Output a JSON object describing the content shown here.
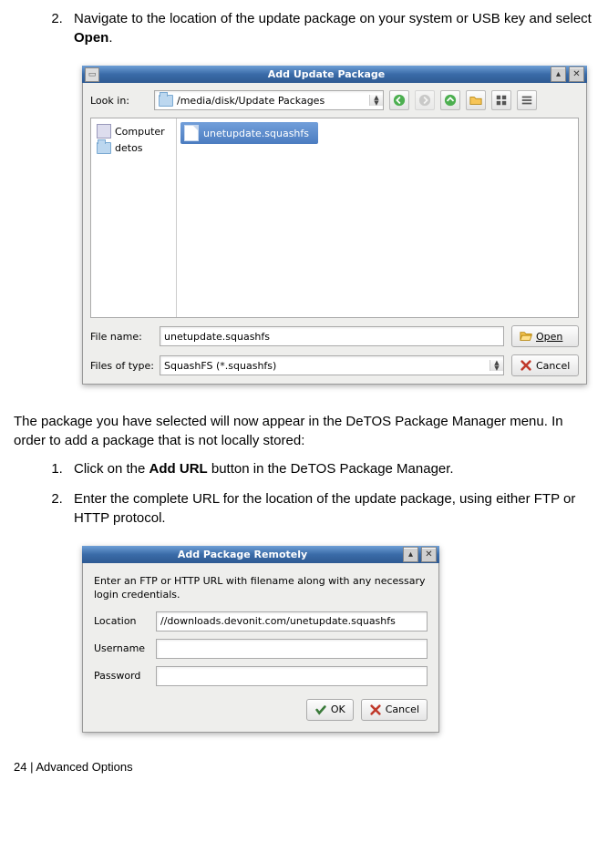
{
  "step2": {
    "number": "2.",
    "pre": "Navigate to the location of the update package on your system or USB key and select ",
    "bold": "Open",
    "post": "."
  },
  "dialog1": {
    "title": "Add Update Package",
    "look_in_label": "Look in:",
    "look_in_value": "/media/disk/Update Packages",
    "side_items": [
      "Computer",
      "detos"
    ],
    "selected_file": "unetupdate.squashfs",
    "file_name_label": "File name:",
    "file_name_value": "unetupdate.squashfs",
    "file_type_label": "Files of type:",
    "file_type_value": "SquashFS (*.squashfs)",
    "open_btn": "Open",
    "cancel_btn": "Cancel"
  },
  "paragraph": "The package you have selected will now appear in the DeTOS Package Manager menu.  In order to add a package that is not locally stored:",
  "list2": {
    "item1_pre": "Click on the ",
    "item1_bold": "Add URL",
    "item1_post": " button in the DeTOS Package Manager.",
    "item2": "Enter the complete URL for the location of the update package, using either FTP or HTTP protocol."
  },
  "dialog2": {
    "title": "Add Package Remotely",
    "intro": "Enter an FTP or HTTP URL with filename along with any necessary login credentials.",
    "loc_label": "Location",
    "loc_value": "//downloads.devonit.com/unetupdate.squashfs",
    "user_label": "Username",
    "user_value": "",
    "pass_label": "Password",
    "pass_value": "",
    "ok_btn": "OK",
    "cancel_btn": "Cancel"
  },
  "footer": "24 | Advanced Options"
}
